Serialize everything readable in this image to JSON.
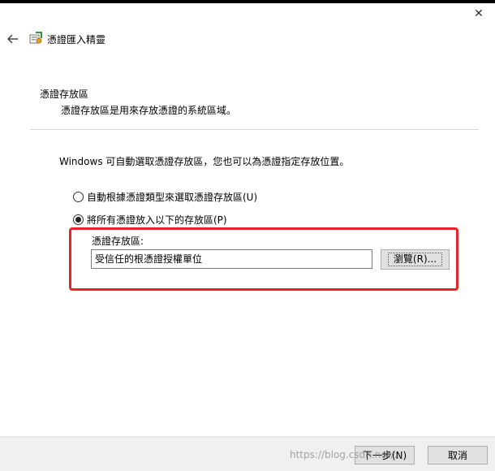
{
  "window": {
    "close_glyph": "✕"
  },
  "wizard": {
    "title": "憑證匯入精靈",
    "back_glyph": "←"
  },
  "section": {
    "title": "憑證存放區",
    "description": "憑證存放區是用來存放憑證的系統區域。"
  },
  "instruction": "Windows 可自動選取憑證存放區，您也可以為憑證指定存放位置。",
  "options": [
    {
      "label": "自動根據憑證類型來選取憑證存放區(U)",
      "checked": false
    },
    {
      "label": "將所有憑證放入以下的存放區(P)",
      "checked": true
    }
  ],
  "store": {
    "label": "憑證存放區:",
    "value": "受信任的根憑證授權單位",
    "browse_label": "瀏覽(R)..."
  },
  "footer": {
    "next_label": "下一步(N)",
    "cancel_label": "取消",
    "watermark": "https://blog.csdn.net/..."
  },
  "colors": {
    "highlight": "#e8242a",
    "footer_bg": "#f0f0f0",
    "button_bg": "#e1e1e1"
  },
  "icons": [
    "close-icon",
    "back-arrow-icon",
    "certificate-wizard-icon"
  ]
}
